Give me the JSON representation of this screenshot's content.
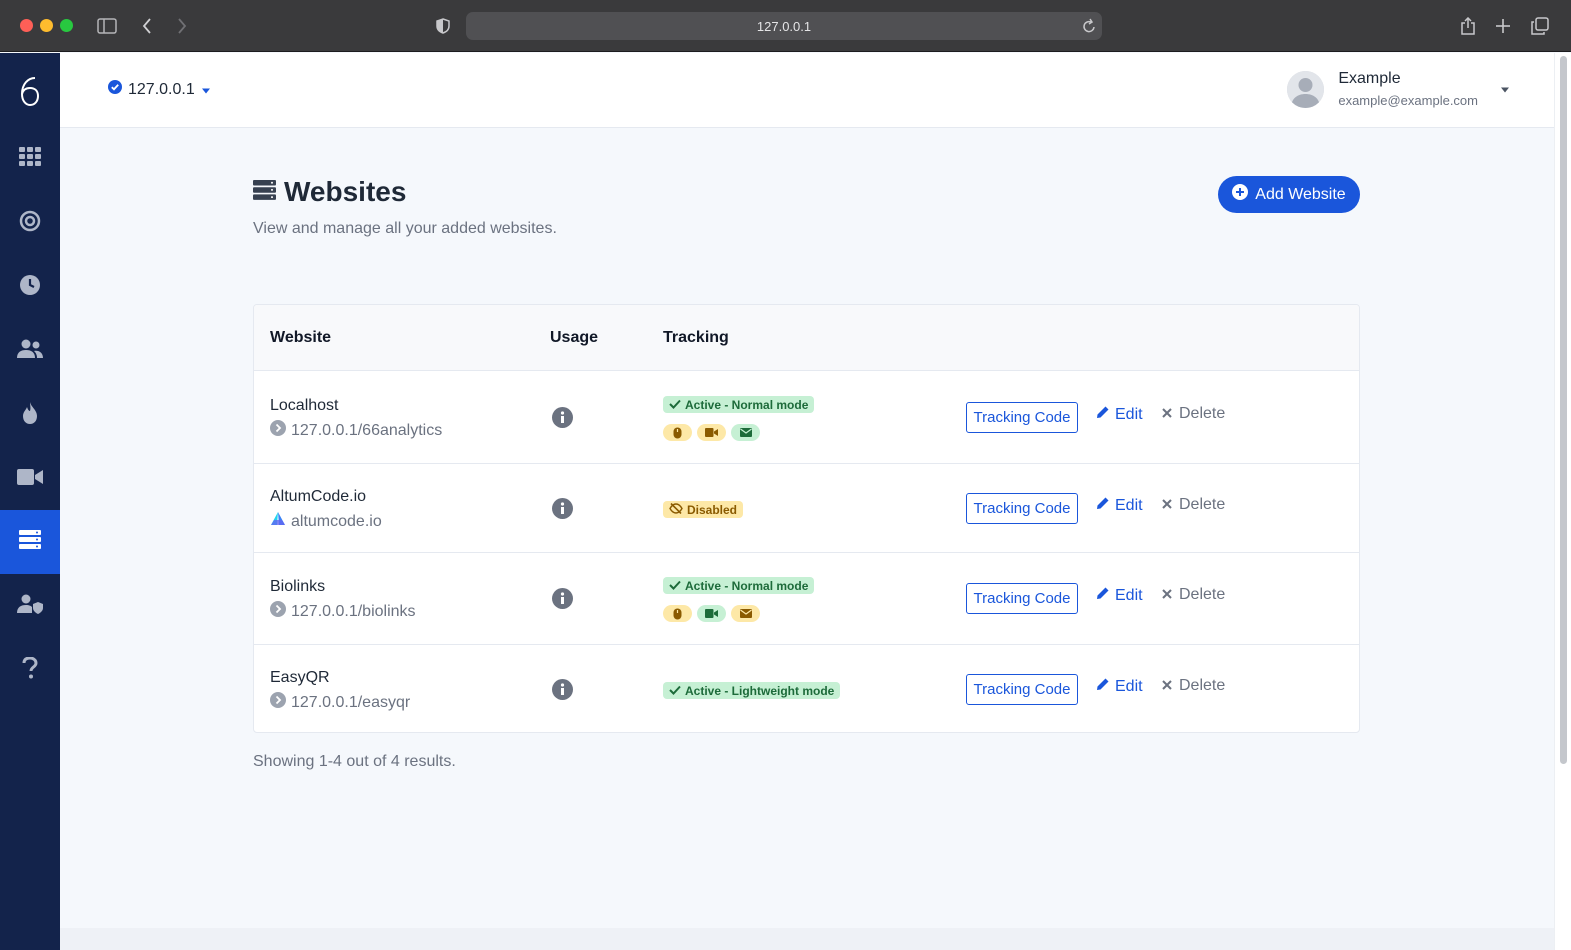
{
  "browser": {
    "url": "127.0.0.1"
  },
  "header": {
    "site_selector": "127.0.0.1",
    "user_name": "Example",
    "user_email": "example@example.com"
  },
  "page": {
    "title": "Websites",
    "subtitle": "View and manage all your added websites.",
    "add_button": "Add Website"
  },
  "table": {
    "columns": [
      "Website",
      "Usage",
      "Tracking"
    ],
    "rows": [
      {
        "name": "Localhost",
        "url": "127.0.0.1/66analytics",
        "status": "Active - Normal mode",
        "status_color": "green",
        "features": [
          {
            "icon": "mouse-icon",
            "color": "yellow"
          },
          {
            "icon": "video-icon",
            "color": "yellow"
          },
          {
            "icon": "envelope-icon",
            "color": "green"
          }
        ]
      },
      {
        "name": "AltumCode.io",
        "url": "altumcode.io",
        "status": "Disabled",
        "status_color": "yellow",
        "features": []
      },
      {
        "name": "Biolinks",
        "url": "127.0.0.1/biolinks",
        "status": "Active - Normal mode",
        "status_color": "green",
        "features": [
          {
            "icon": "mouse-icon",
            "color": "yellow"
          },
          {
            "icon": "video-icon",
            "color": "green"
          },
          {
            "icon": "envelope-icon",
            "color": "yellow"
          }
        ]
      },
      {
        "name": "EasyQR",
        "url": "127.0.0.1/easyqr",
        "status": "Active - Lightweight mode",
        "status_color": "green",
        "features": []
      }
    ],
    "actions": {
      "tracking_code": "Tracking Code",
      "edit": "Edit",
      "delete": "Delete"
    }
  },
  "pagination": {
    "summary": "Showing 1-4 out of 4 results."
  },
  "sidebar": {
    "items": [
      {
        "icon": "dashboard-grid-icon",
        "active": false
      },
      {
        "icon": "realtime-target-icon",
        "active": false
      },
      {
        "icon": "clock-icon",
        "active": false
      },
      {
        "icon": "users-icon",
        "active": false
      },
      {
        "icon": "fire-heatmap-icon",
        "active": false
      },
      {
        "icon": "video-recordings-icon",
        "active": false
      },
      {
        "icon": "websites-server-icon",
        "active": true
      },
      {
        "icon": "team-icon",
        "active": false
      },
      {
        "icon": "help-icon",
        "active": false
      }
    ]
  },
  "colors": {
    "sidebar": "#13234b",
    "primary": "#1a56db",
    "active_badge": "#c6f0d4",
    "warning_badge": "#fde8a7"
  }
}
